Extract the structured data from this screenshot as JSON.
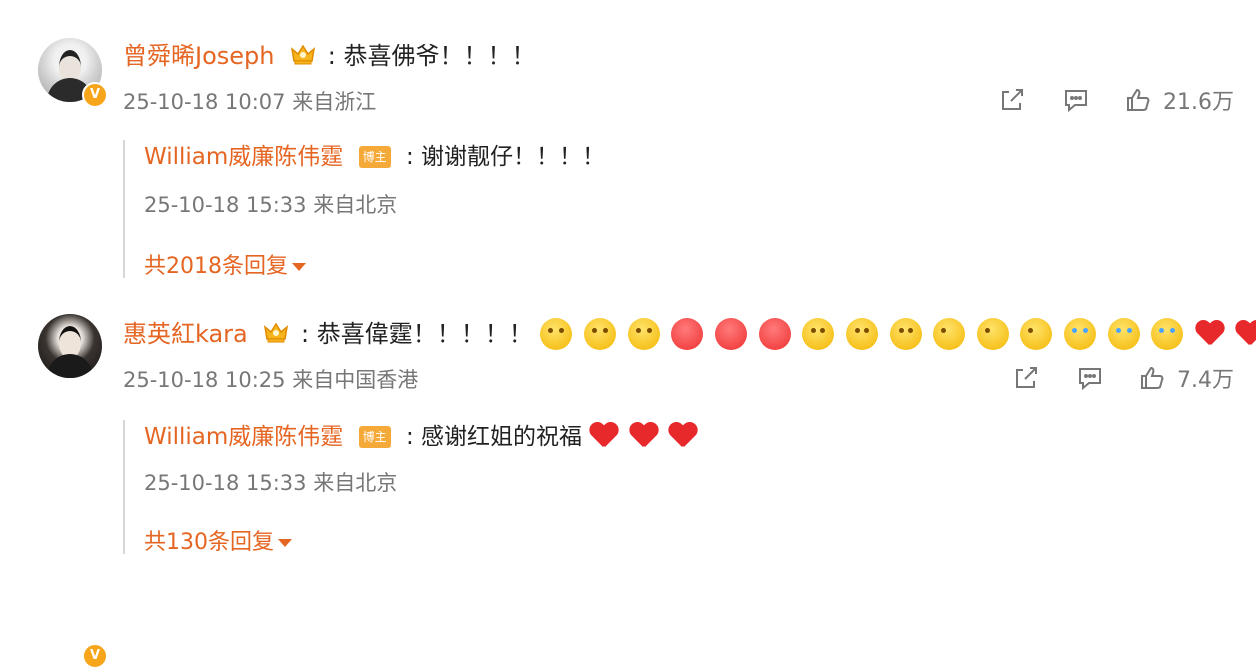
{
  "comments": [
    {
      "user": {
        "name": "曾舜晞Joseph",
        "avatar_icon": "male-avatar-icon",
        "verified_icon": "verified-badge-icon",
        "crown_icon": "crown-badge-icon"
      },
      "separator": ":",
      "text": "恭喜佛爷！！！！",
      "timestamp": "25-10-18 10:07 来自浙江",
      "likes": "21.6万",
      "reply": {
        "user": "William威廉陈伟霆",
        "badge": "博主",
        "separator": ":",
        "text": "谢谢靓仔！！！！",
        "timestamp": "25-10-18 15:33 来自北京"
      },
      "more_replies": "共2018条回复"
    },
    {
      "user": {
        "name": "惠英紅kara",
        "avatar_icon": "female-avatar-icon",
        "verified_icon": "verified-badge-icon",
        "crown_icon": "crown-badge-icon"
      },
      "separator": ":",
      "text": "恭喜偉霆！！！！！",
      "emojis": [
        "scream-emoji",
        "scream-emoji",
        "scream-emoji",
        "heart-eyes-emoji",
        "heart-eyes-emoji",
        "heart-eyes-emoji",
        "wow-emoji",
        "wow-emoji",
        "wow-emoji",
        "tongue-wink-emoji",
        "tongue-wink-emoji",
        "tongue-wink-emoji",
        "crying-emoji",
        "crying-emoji",
        "crying-emoji",
        "red-heart-icon",
        "red-heart-icon",
        "red-heart-icon"
      ],
      "timestamp": "25-10-18 10:25 来自中国香港",
      "likes": "7.4万",
      "reply": {
        "user": "William威廉陈伟霆",
        "badge": "博主",
        "separator": ":",
        "text": "感谢红姐的祝福",
        "emojis": [
          "red-heart-icon",
          "red-heart-icon",
          "red-heart-icon"
        ],
        "timestamp": "25-10-18 15:33 来自北京"
      },
      "more_replies": "共130条回复"
    }
  ],
  "icons": {
    "share": "share-icon",
    "comment": "comment-icon",
    "like": "thumbs-up-icon",
    "expand": "caret-down-icon"
  },
  "colors": {
    "username": "#e56522",
    "badge": "#f4a938",
    "meta": "#777777",
    "text": "#222222",
    "reply_bar": "#d7d7d7"
  }
}
